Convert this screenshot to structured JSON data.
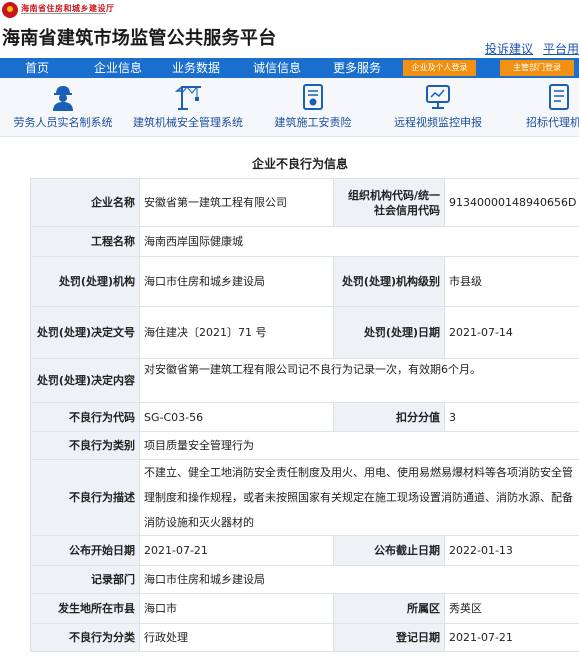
{
  "header": {
    "org_name": "海南省住房和城乡建设厅",
    "site_title": "海南省建筑市场监管公共服务平台",
    "links": [
      "投诉建议",
      "平台用"
    ]
  },
  "nav": {
    "items": [
      "首页",
      "企业信息",
      "业务数据",
      "诚信信息",
      "更多服务"
    ],
    "buttons": [
      "企业及个人登录",
      "主管部门登录"
    ]
  },
  "services": [
    {
      "label": "劳务人员实名制系统",
      "icon": "worker-icon"
    },
    {
      "label": "建筑机械安全管理系统",
      "icon": "crane-icon"
    },
    {
      "label": "建筑施工安责险",
      "icon": "insurance-doc-icon"
    },
    {
      "label": "远程视频监控申报",
      "icon": "monitor-icon"
    },
    {
      "label": "招标代理机构",
      "icon": "document-icon"
    }
  ],
  "record": {
    "title": "企业不良行为信息",
    "company_label": "企业名称",
    "company": "安徽省第一建筑工程有限公司",
    "orgcode_label": "组织机构代码/统一社会信用代码",
    "orgcode": "91340000148940656D",
    "project_label": "工程名称",
    "project": "海南西岸国际健康城",
    "authority_label": "处罚(处理)机构",
    "authority": "海口市住房和城乡建设局",
    "authority_level_label": "处罚(处理)机构级别",
    "authority_level": "市县级",
    "decision_no_label": "处罚(处理)决定文号",
    "decision_no": "海住建决〔2021〕71 号",
    "decision_date_label": "处罚(处理)日期",
    "decision_date": "2021-07-14",
    "decision_content_label": "处罚(处理)决定内容",
    "decision_content": "对安徽省第一建筑工程有限公司记不良行为记录一次，有效期6个月。",
    "code_label": "不良行为代码",
    "code": "SG-C03-56",
    "score_label": "扣分分值",
    "score": "3",
    "category_label": "不良行为类别",
    "category": "项目质量安全管理行为",
    "description_label": "不良行为描述",
    "description": "不建立、健全工地消防安全责任制度及用火、用电、使用易燃易爆材料等各项消防安全管理制度和操作规程，或者未按照国家有关规定在施工现场设置消防通道、消防水源、配备消防设施和灭火器材的",
    "pub_start_label": "公布开始日期",
    "pub_start": "2021-07-21",
    "pub_end_label": "公布截止日期",
    "pub_end": "2022-01-13",
    "dept_label": "记录部门",
    "dept": "海口市住房和城乡建设局",
    "city_label": "发生地所在市县",
    "city": "海口市",
    "district_label": "所属区",
    "district": "秀英区",
    "class_label": "不良行为分类",
    "class": "行政处理",
    "reg_date_label": "登记日期",
    "reg_date": "2021-07-21"
  },
  "colors": {
    "nav": "#1a6fce",
    "nav_button": "#f29111",
    "logo": "#c8161d",
    "link": "#1a55b5"
  }
}
